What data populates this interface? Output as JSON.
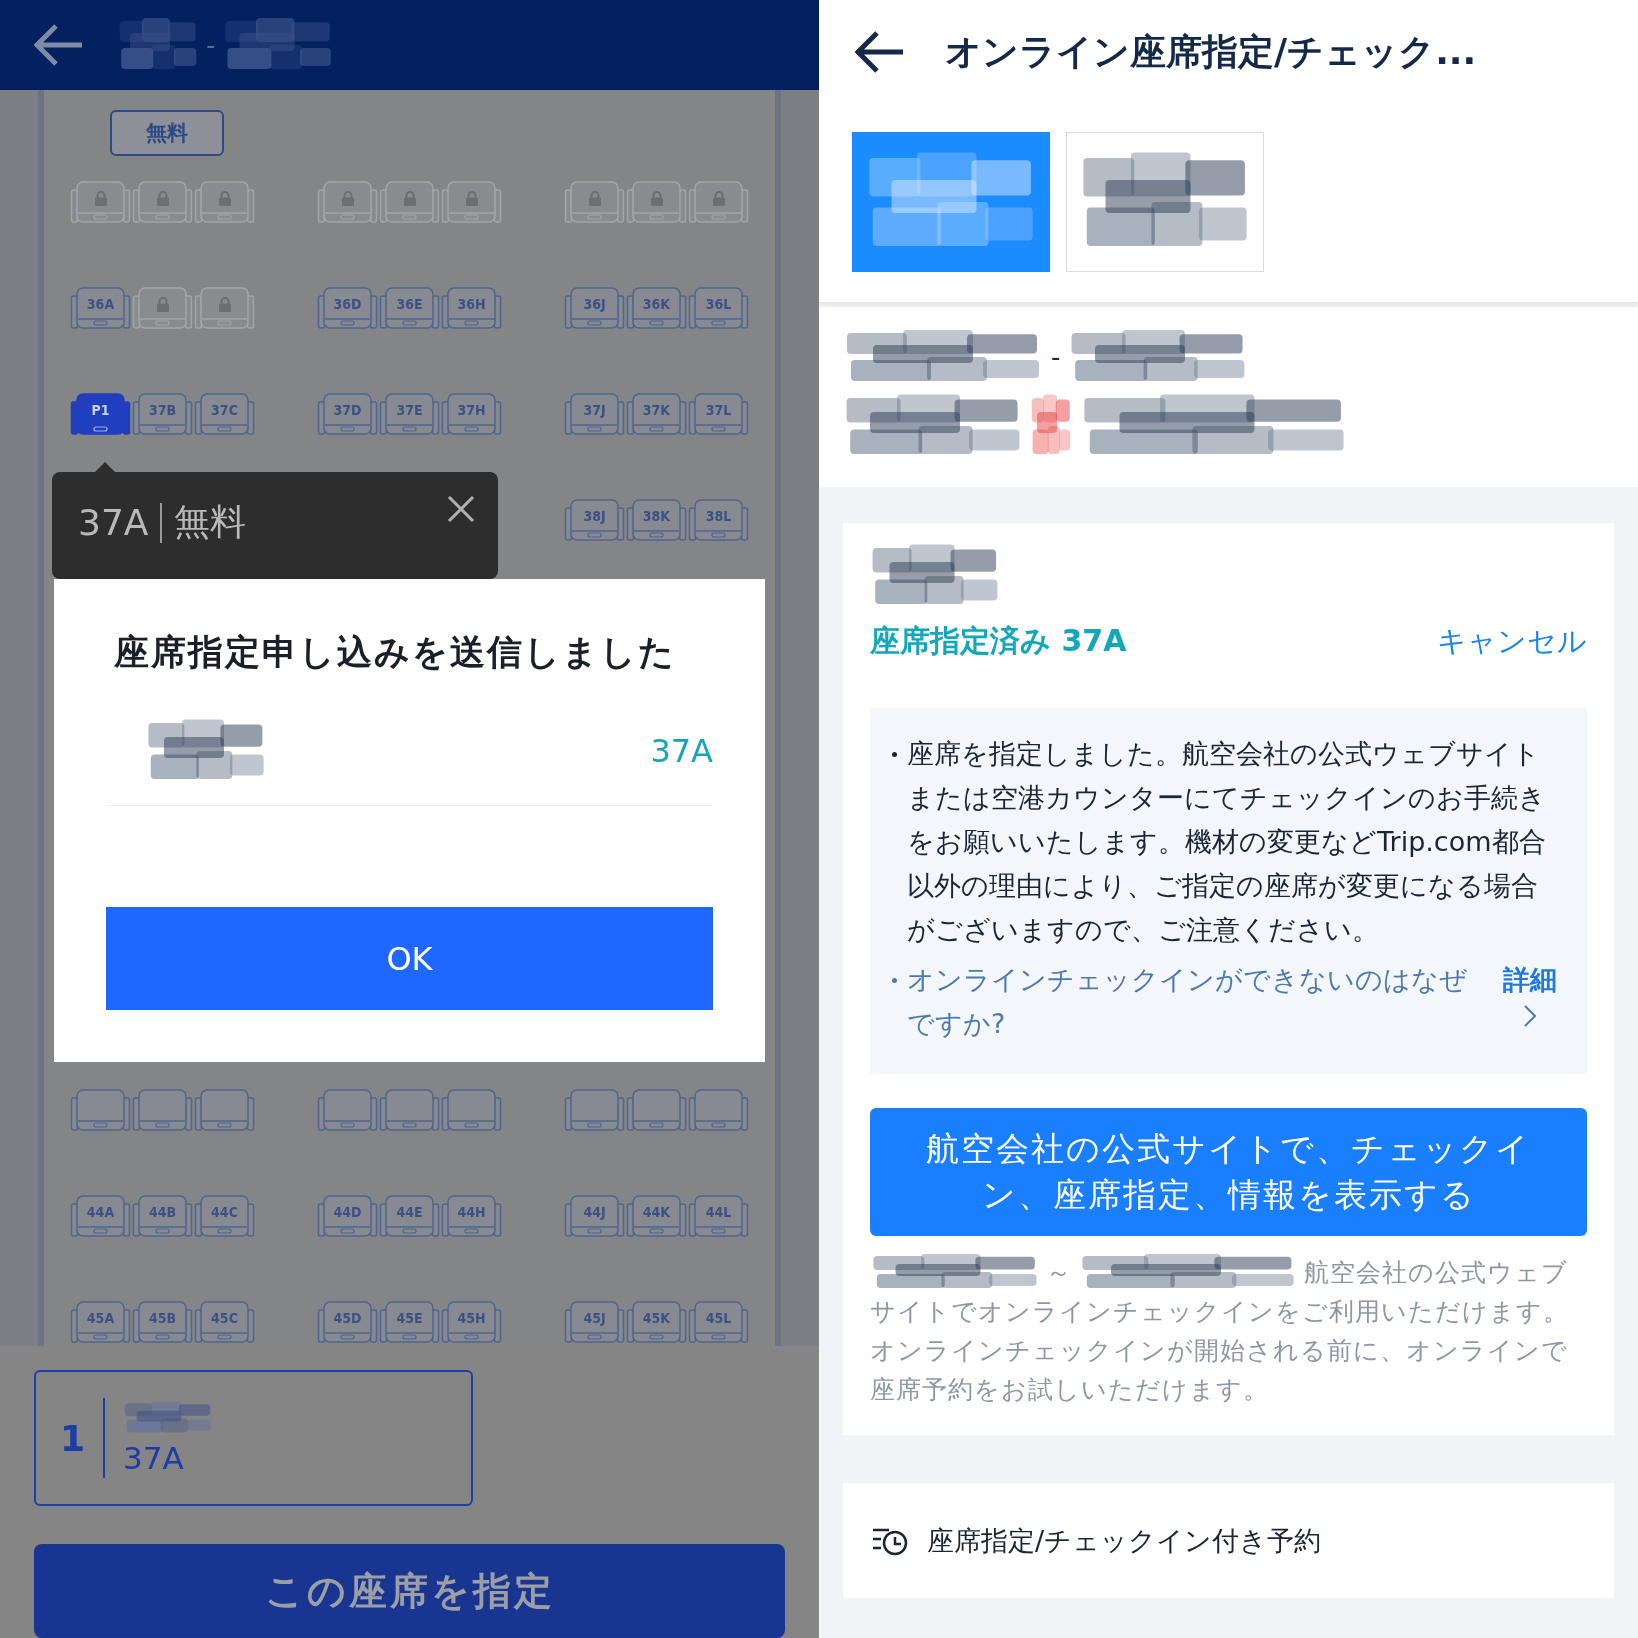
{
  "seat_map": {
    "header": {
      "route_separator": "-"
    },
    "fare_badge": "無料",
    "rows_upper": [
      {
        "seats": [
          {
            "locked": true,
            "selected": false
          },
          {
            "locked": true,
            "selected": false
          },
          {
            "locked": true,
            "selected": false
          },
          {
            "locked": true,
            "selected": false
          },
          {
            "locked": true,
            "selected": false
          },
          {
            "locked": true,
            "selected": false
          },
          {
            "locked": true,
            "selected": false
          },
          {
            "locked": true,
            "selected": false
          },
          {
            "locked": true,
            "selected": false
          }
        ]
      },
      {
        "seats": [
          {
            "label": "36A",
            "locked": false,
            "selected": false
          },
          {
            "locked": true,
            "selected": false
          },
          {
            "locked": true,
            "selected": false
          },
          {
            "label": "36D",
            "locked": false,
            "selected": false
          },
          {
            "label": "36E",
            "locked": false,
            "selected": false
          },
          {
            "label": "36H",
            "locked": false,
            "selected": false
          },
          {
            "label": "36J",
            "locked": false,
            "selected": false
          },
          {
            "label": "36K",
            "locked": false,
            "selected": false
          },
          {
            "label": "36L",
            "locked": false,
            "selected": false
          }
        ]
      },
      {
        "seats": [
          {
            "label": "P1",
            "locked": false,
            "selected": true
          },
          {
            "label": "37B",
            "locked": false,
            "selected": false
          },
          {
            "label": "37C",
            "locked": false,
            "selected": false
          },
          {
            "label": "37D",
            "locked": false,
            "selected": false
          },
          {
            "label": "37E",
            "locked": false,
            "selected": false
          },
          {
            "label": "37H",
            "locked": false,
            "selected": false
          },
          {
            "label": "37J",
            "locked": false,
            "selected": false
          },
          {
            "label": "37K",
            "locked": false,
            "selected": false
          },
          {
            "label": "37L",
            "locked": false,
            "selected": false
          }
        ]
      },
      {
        "seats": [
          {
            "label": "38J",
            "locked": false,
            "selected": false
          },
          {
            "label": "38K",
            "locked": false,
            "selected": false
          },
          {
            "label": "38L",
            "locked": false,
            "selected": false
          }
        ]
      }
    ],
    "rows_lower": [
      {
        "seats": [
          {
            "locked": false,
            "selected": false
          },
          {
            "locked": false,
            "selected": false
          },
          {
            "locked": false,
            "selected": false
          },
          {
            "locked": false,
            "selected": false
          },
          {
            "locked": false,
            "selected": false
          },
          {
            "locked": false,
            "selected": false
          },
          {
            "locked": false,
            "selected": false
          },
          {
            "locked": false,
            "selected": false
          },
          {
            "locked": false,
            "selected": false
          }
        ]
      },
      {
        "seats": [
          {
            "label": "44A",
            "locked": false,
            "selected": false
          },
          {
            "label": "44B",
            "locked": false,
            "selected": false
          },
          {
            "label": "44C",
            "locked": false,
            "selected": false
          },
          {
            "label": "44D",
            "locked": false,
            "selected": false
          },
          {
            "label": "44E",
            "locked": false,
            "selected": false
          },
          {
            "label": "44H",
            "locked": false,
            "selected": false
          },
          {
            "label": "44J",
            "locked": false,
            "selected": false
          },
          {
            "label": "44K",
            "locked": false,
            "selected": false
          },
          {
            "label": "44L",
            "locked": false,
            "selected": false
          }
        ]
      },
      {
        "seats": [
          {
            "label": "45A",
            "locked": false,
            "selected": false
          },
          {
            "label": "45B",
            "locked": false,
            "selected": false
          },
          {
            "label": "45C",
            "locked": false,
            "selected": false
          },
          {
            "label": "45D",
            "locked": false,
            "selected": false
          },
          {
            "label": "45E",
            "locked": false,
            "selected": false
          },
          {
            "label": "45H",
            "locked": false,
            "selected": false
          },
          {
            "label": "45J",
            "locked": false,
            "selected": false
          },
          {
            "label": "45K",
            "locked": false,
            "selected": false
          },
          {
            "label": "45L",
            "locked": false,
            "selected": false
          }
        ]
      }
    ],
    "tooltip": {
      "seat": "37A",
      "fare": "無料"
    },
    "passenger": {
      "index": "1",
      "seat": "37A"
    },
    "confirm_button": "この座席を指定"
  },
  "dialog": {
    "title": "座席指定申し込みを送信しました",
    "seat": "37A",
    "ok_button": "OK"
  },
  "checkin_page": {
    "title": "オンライン座席指定/チェック...",
    "tabs": [
      {
        "selected": true
      },
      {
        "selected": false
      }
    ],
    "route_separator": "-",
    "status": "座席指定済み 37A",
    "cancel": "キャンセル",
    "notice": "座席を指定しました。航空会社の公式ウェブサイトまたは空港カウンターにてチェックインのお手続きをお願いいたします。機材の変更などTrip.com都合以外の理由により、ご指定の座席が変更になる場合がございますので、ご注意ください。",
    "faq_link": "オンラインチェックインができないのはなぜですか?",
    "details_link": "詳細",
    "airline_button": "航空会社の公式サイトで、チェックイン、座席指定、情報を表示する",
    "note": {
      "separator": "～",
      "lead": "航空会社の公式ウェブ",
      "text": "サイトでオンラインチェックインをご利用いただけます。オンラインチェックインが開始される前に、オンラインで座席予約をお試しいただけます。"
    },
    "booking_option": "座席指定/チェックイン付き予約"
  }
}
